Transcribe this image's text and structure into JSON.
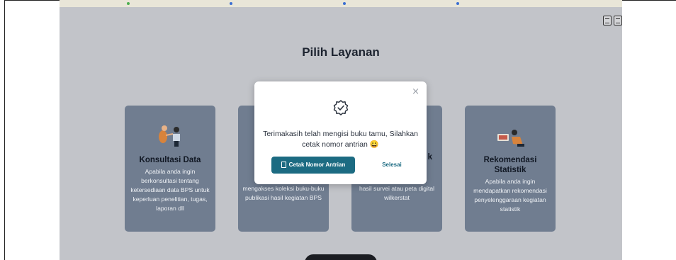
{
  "page": {
    "title": "Pilih Layanan",
    "header_icons": [
      "document-icon",
      "contact-card-icon"
    ]
  },
  "cards": [
    {
      "title": "Konsultasi Data",
      "description": "Apabila anda ingin berkonsultasi tentang ketersediaan data BPS untuk keperluan penelitian, tugas, laporan dll"
    },
    {
      "title": "",
      "description": "mengakses koleksi buku-buku publikasi hasil kegiatan BPS"
    },
    {
      "title": "k",
      "description": "hasil survei atau peta digital wilkerstat"
    },
    {
      "title": "Rekomendasi Statistik",
      "description": "Apabila anda ingin mendapatkan rekomendasi penyelenggaraan kegiatan statistik"
    }
  ],
  "modal": {
    "close_label": "×",
    "message": "Terimakasih telah mengisi buku tamu, Silahkan cetak nomor antrian 😀",
    "print_button": "Cetak Nomor Antrian",
    "done_button": "Selesai",
    "icon": "check-badge-icon"
  },
  "colors": {
    "overlay_bg": "#c2c4c9",
    "card_bg": "#707d90",
    "primary": "#1c6b82"
  }
}
